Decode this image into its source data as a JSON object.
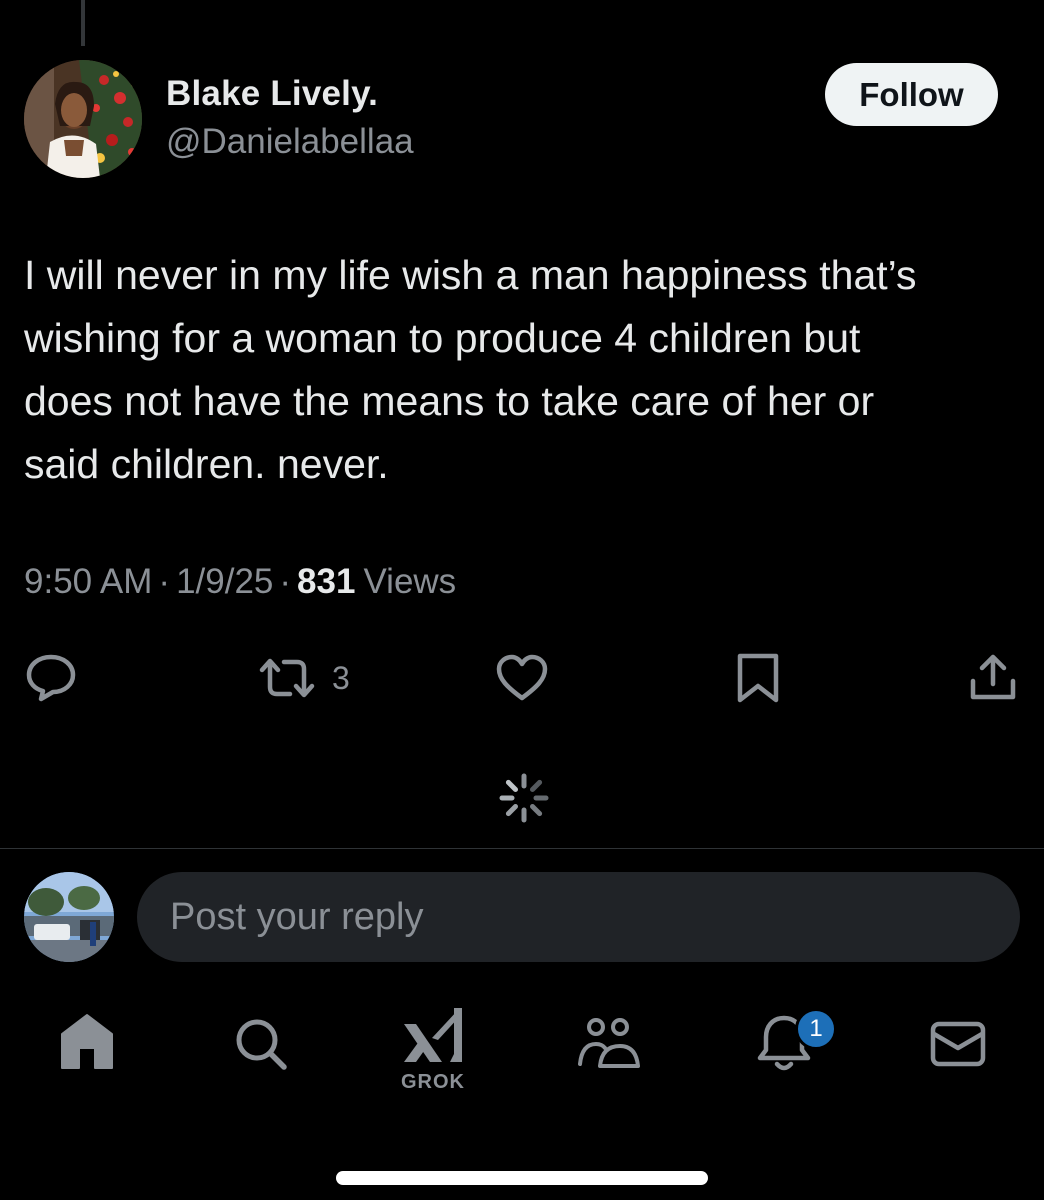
{
  "post": {
    "author_name": "Blake Lively.",
    "author_handle": "@Danielabellaa",
    "follow_label": "Follow",
    "text": "I will never in my life wish a man happiness that’s\nwishing for a woman to produce 4 children but\ndoes not have the means to take care of her or\nsaid children. never.",
    "time": "9:50 AM",
    "date": "1/9/25",
    "separator": "·",
    "views_count": "831",
    "views_label": "Views"
  },
  "actions": {
    "reply_icon": "comment-bubble-icon",
    "retweet_icon": "retweet-icon",
    "retweet_count": "3",
    "like_icon": "heart-icon",
    "bookmark_icon": "bookmark-icon",
    "share_icon": "share-upload-icon"
  },
  "reply_box": {
    "placeholder": "Post your reply"
  },
  "tabbar": {
    "home_icon": "home-icon",
    "search_icon": "search-icon",
    "grok_label": "GROK",
    "communities_icon": "communities-icon",
    "notifications_icon": "bell-icon",
    "notification_badge": "1",
    "messages_icon": "mail-icon"
  },
  "colors": {
    "background": "#000000",
    "text_primary": "#e7e9ea",
    "text_secondary": "#8b9096",
    "badge": "#1d6fb8",
    "reply_field": "#202327"
  }
}
